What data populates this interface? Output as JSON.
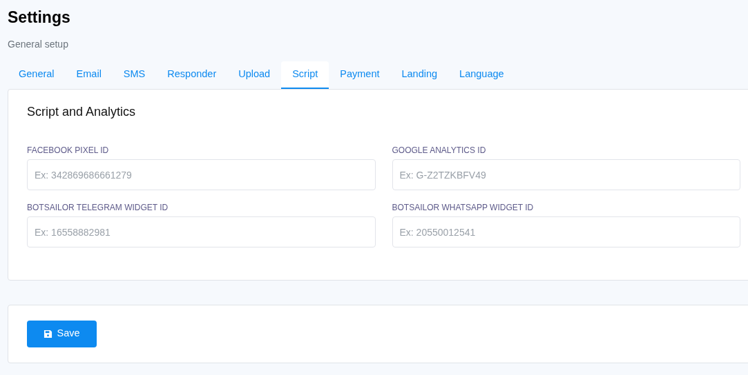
{
  "page": {
    "title": "Settings",
    "subtitle": "General setup"
  },
  "tabs": [
    {
      "label": "General",
      "selected": false
    },
    {
      "label": "Email",
      "selected": false
    },
    {
      "label": "SMS",
      "selected": false
    },
    {
      "label": "Responder",
      "selected": false
    },
    {
      "label": "Upload",
      "selected": false
    },
    {
      "label": "Script",
      "selected": true
    },
    {
      "label": "Payment",
      "selected": false
    },
    {
      "label": "Landing",
      "selected": false
    },
    {
      "label": "Language",
      "selected": false
    }
  ],
  "section": {
    "title": "Script and Analytics",
    "fields": [
      {
        "label": "FACEBOOK PIXEL ID",
        "placeholder": "Ex: 342869686661279"
      },
      {
        "label": "GOOGLE ANALYTICS ID",
        "placeholder": "Ex: G-Z2TZKBFV49"
      },
      {
        "label": "BOTSAILOR TELEGRAM WIDGET ID",
        "placeholder": "Ex: 16558882981"
      },
      {
        "label": "BOTSAILOR WHATSAPP WIDGET ID",
        "placeholder": "Ex: 20550012541"
      }
    ]
  },
  "save_button": {
    "label": "Save"
  }
}
